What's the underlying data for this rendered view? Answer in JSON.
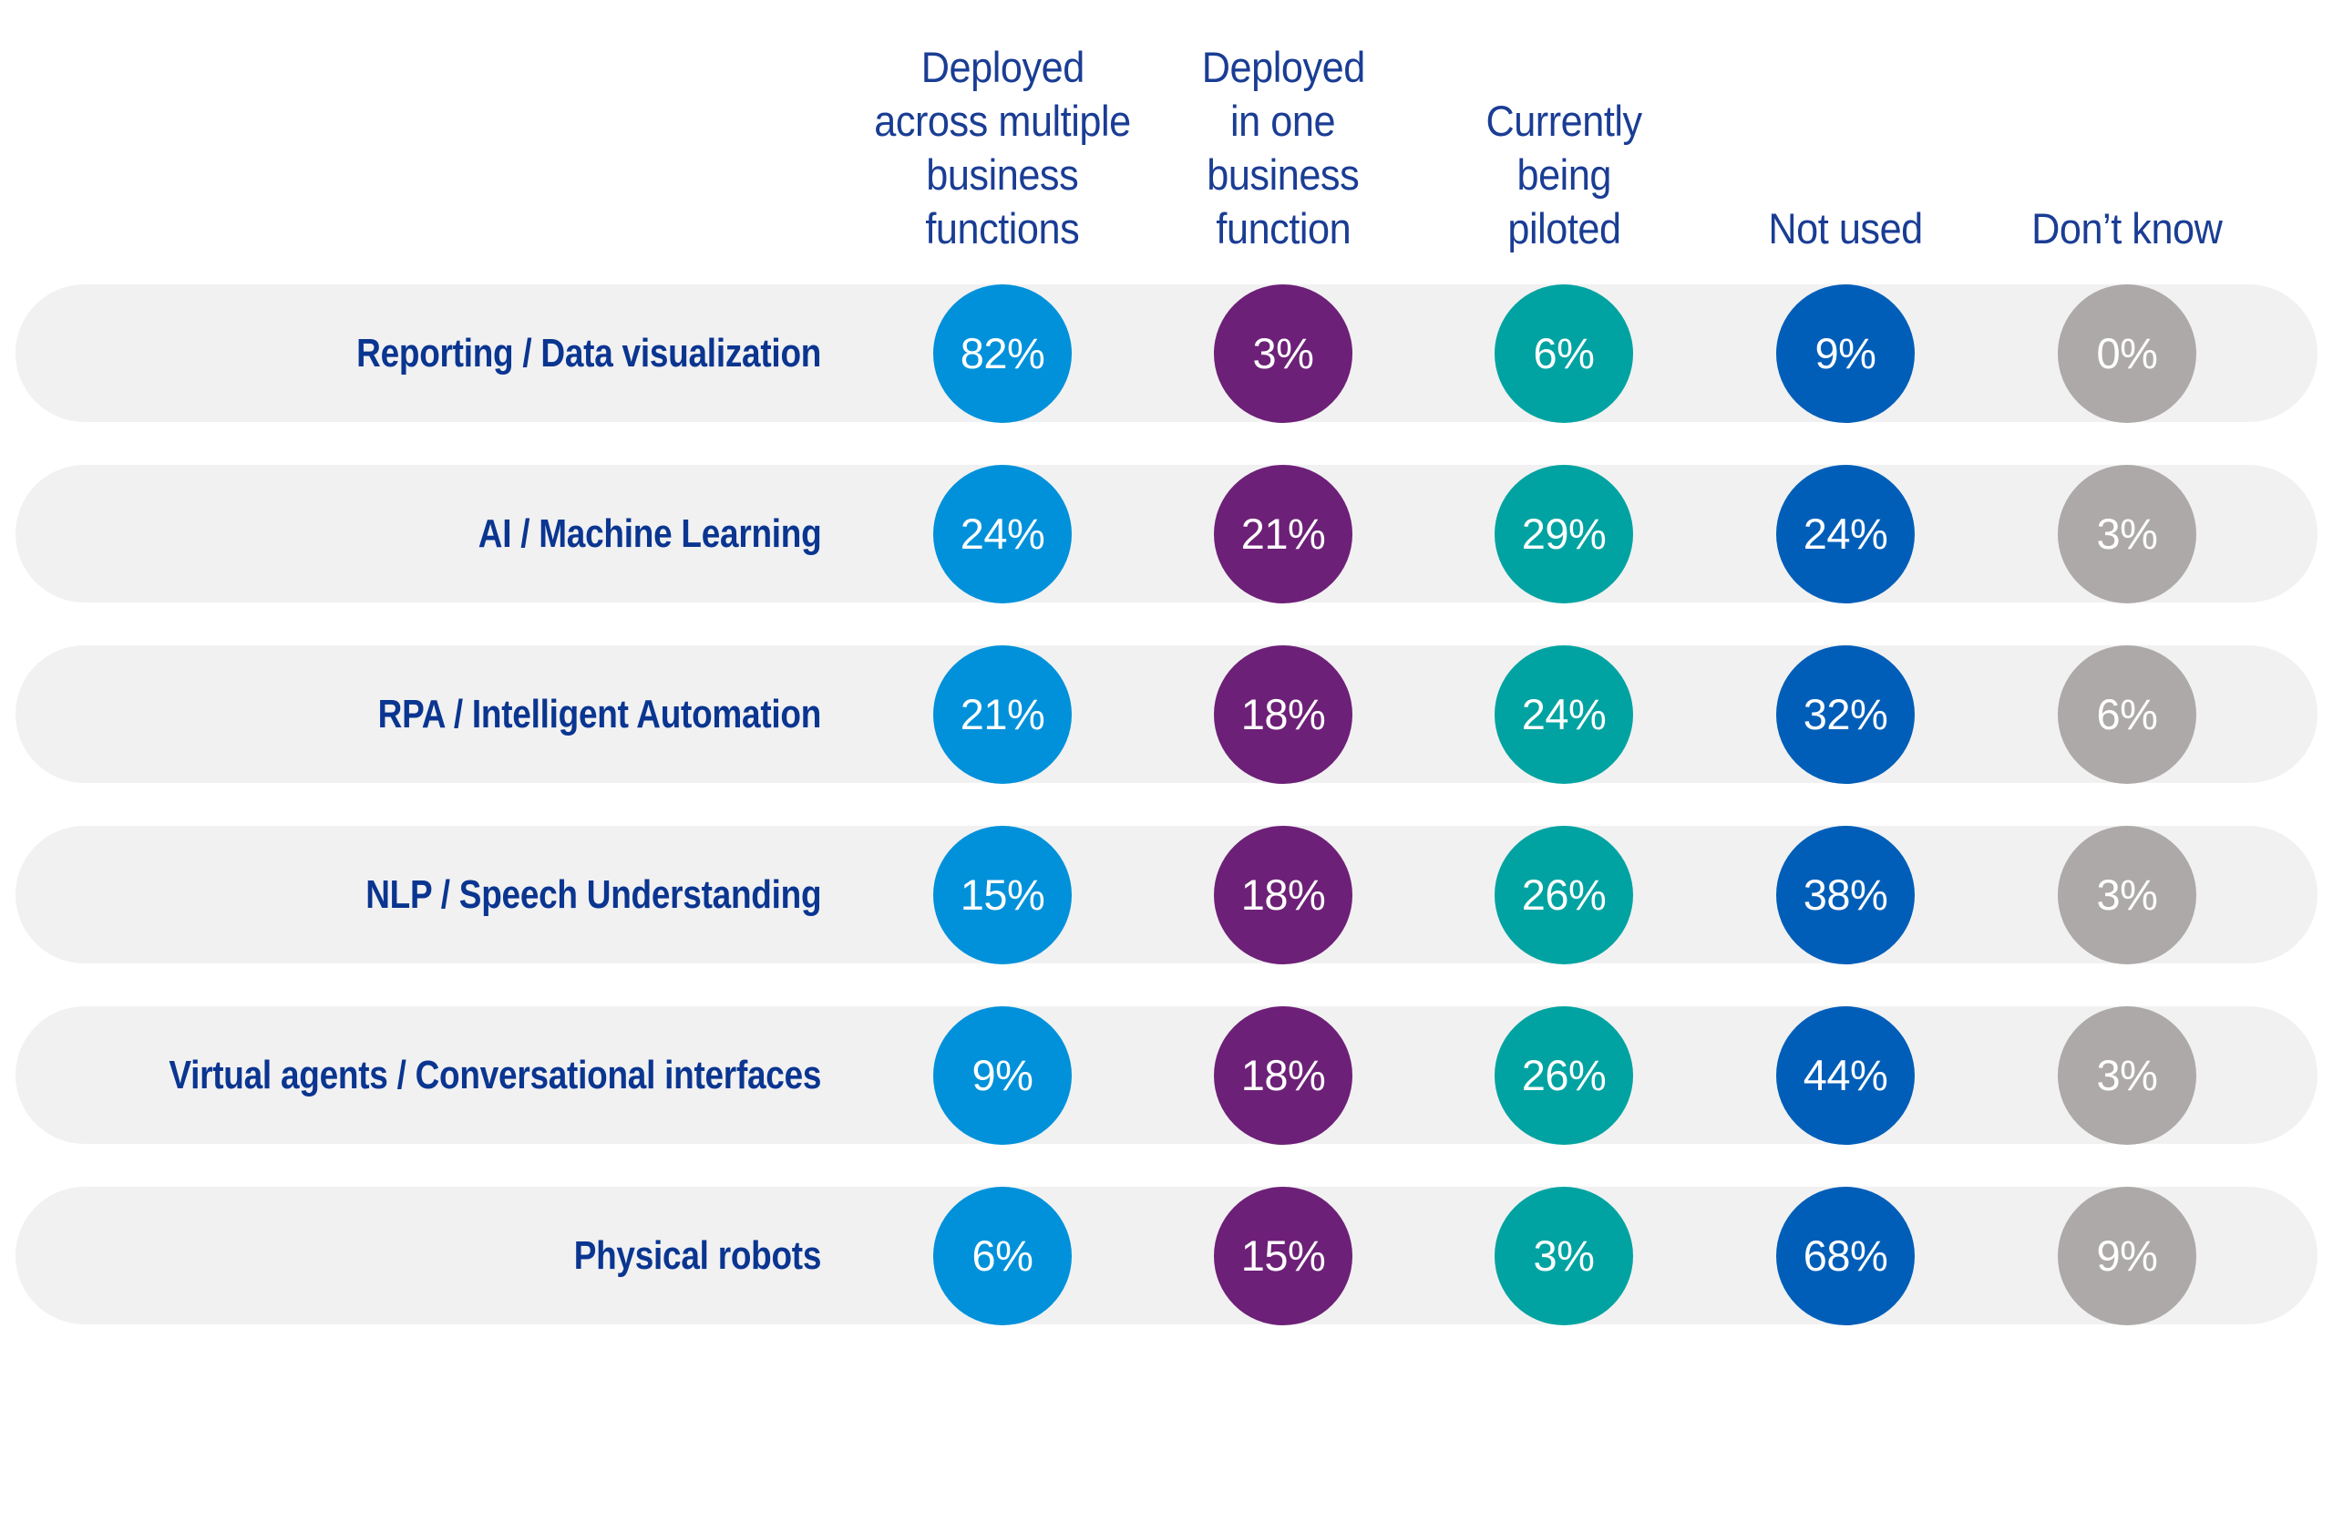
{
  "chart_data": {
    "type": "table",
    "title": "",
    "columns": [
      {
        "key": "multi",
        "label_lines": [
          "Deployed",
          "across multiple",
          "business",
          "functions"
        ],
        "color": "#0091da"
      },
      {
        "key": "one",
        "label_lines": [
          "Deployed",
          "in one",
          "business",
          "function"
        ],
        "color": "#6d2077"
      },
      {
        "key": "pilot",
        "label_lines": [
          "Currently",
          "being",
          "piloted"
        ],
        "color": "#00a3a1"
      },
      {
        "key": "notused",
        "label_lines": [
          "Not used"
        ],
        "color": "#005eb8"
      },
      {
        "key": "dontknow",
        "label_lines": [
          "Don’t know"
        ],
        "color": "#aca9a8"
      }
    ],
    "rows": [
      {
        "label": "Reporting / Data visualization",
        "values": [
          82,
          3,
          6,
          9,
          0
        ]
      },
      {
        "label": "AI / Machine Learning",
        "values": [
          24,
          21,
          29,
          24,
          3
        ]
      },
      {
        "label": "RPA / Intelligent Automation",
        "values": [
          21,
          18,
          24,
          32,
          6
        ]
      },
      {
        "label": "NLP / Speech Understanding",
        "values": [
          15,
          18,
          26,
          38,
          3
        ]
      },
      {
        "label": "Virtual agents / Conversational interfaces",
        "values": [
          9,
          18,
          26,
          44,
          3
        ]
      },
      {
        "label": "Physical robots",
        "values": [
          6,
          15,
          3,
          68,
          9
        ]
      }
    ],
    "value_suffix": "%",
    "units": "percent of respondents",
    "legend": "column headers at top"
  },
  "colors": {
    "header_text": "#1a3d94",
    "row_label_text": "#0a3590",
    "row_background": "#f1f1f2",
    "bubble_text": "#ffffff"
  }
}
